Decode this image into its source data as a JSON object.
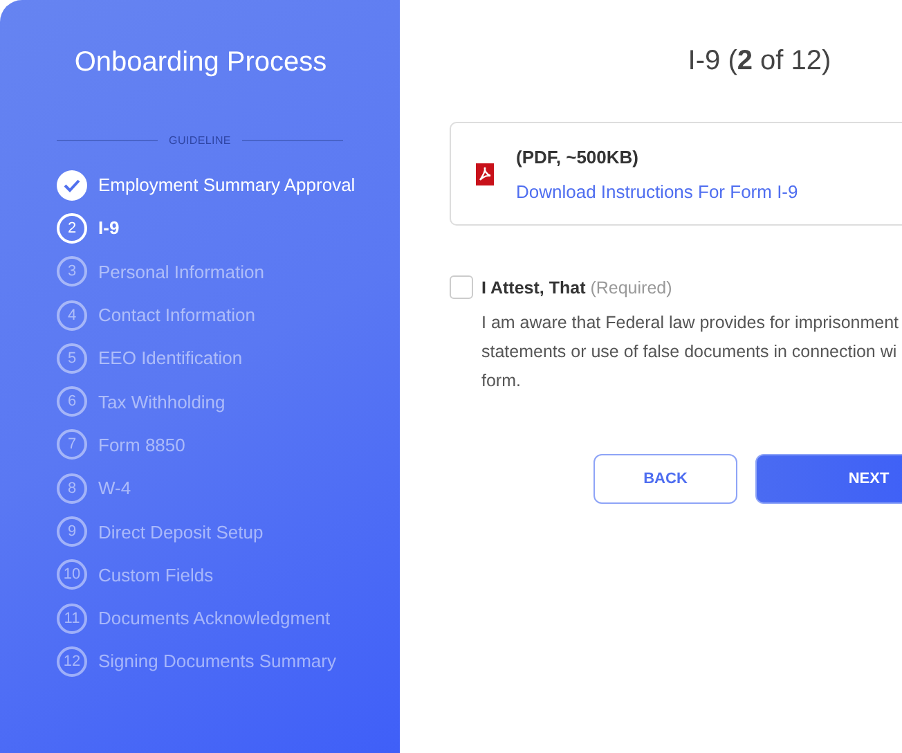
{
  "sidebar": {
    "title": "Onboarding Process",
    "section_label": "GUIDELINE",
    "steps": [
      {
        "label": "Employment Summary Approval",
        "done": true,
        "selected": false
      },
      {
        "number": "2",
        "label": "I-9",
        "done": false,
        "selected": true
      },
      {
        "number": "3",
        "label": "Personal Information",
        "done": false,
        "selected": false
      },
      {
        "number": "4",
        "label": "Contact Information",
        "done": false,
        "selected": false
      },
      {
        "number": "5",
        "label": "EEO Identification",
        "done": false,
        "selected": false
      },
      {
        "number": "6",
        "label": "Tax Withholding",
        "done": false,
        "selected": false
      },
      {
        "number": "7",
        "label": "Form 8850",
        "done": false,
        "selected": false
      },
      {
        "number": "8",
        "label": "W-4",
        "done": false,
        "selected": false
      },
      {
        "number": "9",
        "label": "Direct Deposit Setup",
        "done": false,
        "selected": false
      },
      {
        "number": "10",
        "label": "Custom Fields",
        "done": false,
        "selected": false
      },
      {
        "number": "11",
        "label": "Documents Acknowledgment",
        "done": false,
        "selected": false
      },
      {
        "number": "12",
        "label": "Signing Documents Summary",
        "done": false,
        "selected": false
      }
    ]
  },
  "main": {
    "title": "I-9 (**2** of 12)",
    "download": {
      "size": "(PDF, ~500KB)",
      "link": "Download Instructions For Form I-9"
    },
    "attest": {
      "label": "I Attest, That",
      "hint": "(Required)",
      "checked": false,
      "lines": [
        "I am aware that Federal law provides for imprisonment",
        "statements or use of false documents in connection wi",
        "form."
      ]
    },
    "buttons": [
      {
        "label": "BACK",
        "kind": "secondary"
      },
      {
        "label": "NEXT",
        "kind": "primary"
      }
    ]
  }
}
